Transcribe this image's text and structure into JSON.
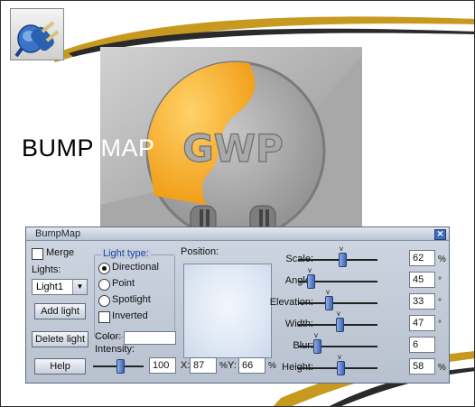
{
  "banner": {
    "title_part1": "BUMP ",
    "title_part2": "MAP"
  },
  "preview": {
    "logo_text": "GWP"
  },
  "dialog": {
    "title": "BumpMap",
    "close_label": "✕",
    "merge_label": "Merge",
    "lights_label": "Lights:",
    "lights_selected": "Light1",
    "add_light_label": "Add light",
    "delete_light_label": "Delete light",
    "help_label": "Help",
    "light_type_label": "Light type:",
    "light_types": [
      "Directional",
      "Point",
      "Spotlight"
    ],
    "light_type_selected": "Directional",
    "inverted_label": "Inverted",
    "color_label": "Color:",
    "intensity_label": "Intensity:",
    "intensity_value": "100",
    "intensity_level": 0.55,
    "position_label": "Position:",
    "x_label": "X:",
    "x_value": "87",
    "x_unit": "%",
    "y_label": "Y:",
    "y_value": "66",
    "y_unit": "%",
    "params": [
      {
        "label": "Scale:",
        "value": "62",
        "unit": "%",
        "level": 0.56
      },
      {
        "label": "Angle:",
        "value": "45",
        "unit": "°",
        "level": 0.12
      },
      {
        "label": "Elevation:",
        "value": "33",
        "unit": "°",
        "level": 0.37
      },
      {
        "label": "Width:",
        "value": "47",
        "unit": "°",
        "level": 0.52
      },
      {
        "label": "Blur:",
        "value": "6",
        "unit": "",
        "level": 0.21
      },
      {
        "label": "Height:",
        "value": "58",
        "unit": "%",
        "level": 0.54
      }
    ]
  }
}
